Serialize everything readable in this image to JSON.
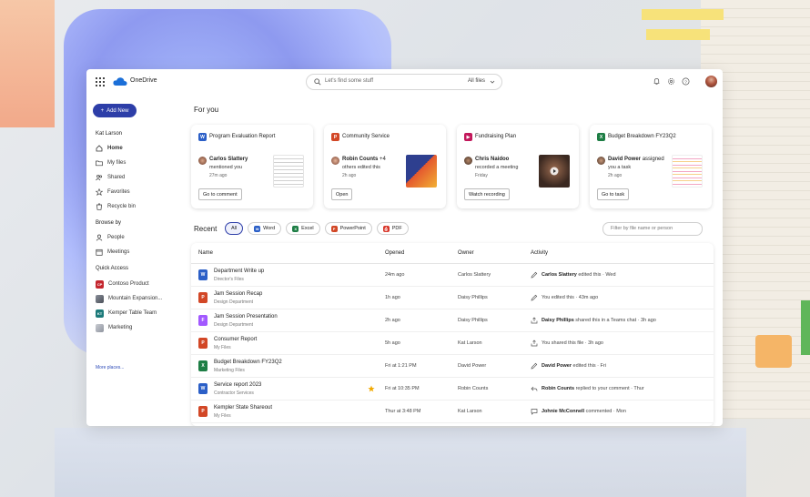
{
  "app": {
    "name": "OneDrive"
  },
  "search": {
    "placeholder": "Let's find some stuff",
    "scope": "All files"
  },
  "sidebar": {
    "new_label": "Add New",
    "user": "Kat Larson",
    "items": [
      {
        "label": "Home",
        "icon": "home-icon"
      },
      {
        "label": "My files",
        "icon": "folder-icon"
      },
      {
        "label": "Shared",
        "icon": "people-icon"
      },
      {
        "label": "Favorites",
        "icon": "star-icon"
      },
      {
        "label": "Recycle bin",
        "icon": "trash-icon"
      }
    ],
    "browse_title": "Browse by",
    "browse": [
      {
        "label": "People",
        "icon": "person-icon"
      },
      {
        "label": "Meetings",
        "icon": "calendar-icon"
      }
    ],
    "quick_title": "Quick Access",
    "quick": [
      {
        "label": "Contoso Product",
        "badge": "CP",
        "color": "#c4262e"
      },
      {
        "label": "Mountain Expansion...",
        "badge": "",
        "color": "#6a6f7a"
      },
      {
        "label": "Kemper Table Team",
        "badge": "KT",
        "color": "#1c7a7a"
      },
      {
        "label": "Marketing",
        "badge": "",
        "color": "#a5a9b2"
      }
    ],
    "more": "More places..."
  },
  "main": {
    "for_you": "For you",
    "cards": [
      {
        "title": "Program Evaluation Report",
        "app": "W",
        "app_color": "#2b5fc7",
        "person": "Carlos Slattery",
        "line1": "mentioned you",
        "line2": "",
        "time": "27m ago",
        "button": "Go to comment"
      },
      {
        "title": "Community Service",
        "app": "P",
        "app_color": "#d24726",
        "person": "Robin Counts",
        "line1": "+4",
        "line2": "others edited this",
        "time": "2h ago",
        "button": "Open"
      },
      {
        "title": "Fundraising Plan",
        "app": "▶",
        "app_color": "#c2185b",
        "person": "Chris Naidoo",
        "line1": "recorded a meeting",
        "line2": "",
        "time": "Friday",
        "button": "Watch recording"
      },
      {
        "title": "Budget Breakdown FY23Q2",
        "app": "X",
        "app_color": "#1e7e45",
        "person": "David Power",
        "line1": "assigned",
        "line2": "you a task",
        "time": "2h ago",
        "button": "Go to task"
      }
    ],
    "recent": "Recent",
    "filters": [
      "All",
      "Word",
      "Excel",
      "PowerPoint",
      "PDF"
    ],
    "filter_placeholder": "Filter by file name or person",
    "columns": {
      "name": "Name",
      "opened": "Opened",
      "owner": "Owner",
      "activity": "Activity"
    },
    "rows": [
      {
        "name": "Department Write up",
        "location": "Director's Files",
        "opened": "24m ago",
        "owner": "Carlos Slattery",
        "actor": "Carlos Slattery",
        "action": "edited this · Wed",
        "type": "W",
        "color": "#2b5fc7",
        "act_icon": "pencil-icon"
      },
      {
        "name": "Jam Session Recap",
        "location": "Design Department",
        "opened": "1h ago",
        "owner": "Daisy Phillips",
        "actor": "",
        "action": "You edited this · 43m ago",
        "type": "P",
        "color": "#d24726",
        "act_icon": "pencil-icon"
      },
      {
        "name": "Jam Session Presentation",
        "location": "Design Department",
        "opened": "2h ago",
        "owner": "Daisy Phillips",
        "actor": "Daisy Phillips",
        "action": "shared this in a Teams chat · 3h ago",
        "type": "F",
        "color": "#a259ff",
        "act_icon": "share-icon"
      },
      {
        "name": "Consumer Report",
        "location": "My Files",
        "opened": "5h ago",
        "owner": "Kat Larson",
        "actor": "",
        "action": "You shared this file · 3h ago",
        "type": "P",
        "color": "#d24726",
        "act_icon": "share-icon"
      },
      {
        "name": "Budget Breakdown FY23Q2",
        "location": "Marketing Files",
        "opened": "Fri at 1:21 PM",
        "owner": "David Power",
        "actor": "David Power",
        "action": "edited this · Fri",
        "type": "X",
        "color": "#1e7e45",
        "act_icon": "pencil-icon"
      },
      {
        "name": "Service report 2023",
        "location": "Contractor Services",
        "opened": "Fri at 10:35 PM",
        "owner": "Robin Counts",
        "actor": "Robin Counts",
        "action": "replied to your comment · Thur",
        "type": "W",
        "color": "#2b5fc7",
        "act_icon": "reply-icon",
        "starred": true
      },
      {
        "name": "Kempler State Shareout",
        "location": "My Files",
        "opened": "Thur at 3:48 PM",
        "owner": "Kat Larson",
        "actor": "Johnie McConnell",
        "action": "commented · Mon",
        "type": "P",
        "color": "#d24726",
        "act_icon": "comment-icon"
      }
    ]
  }
}
